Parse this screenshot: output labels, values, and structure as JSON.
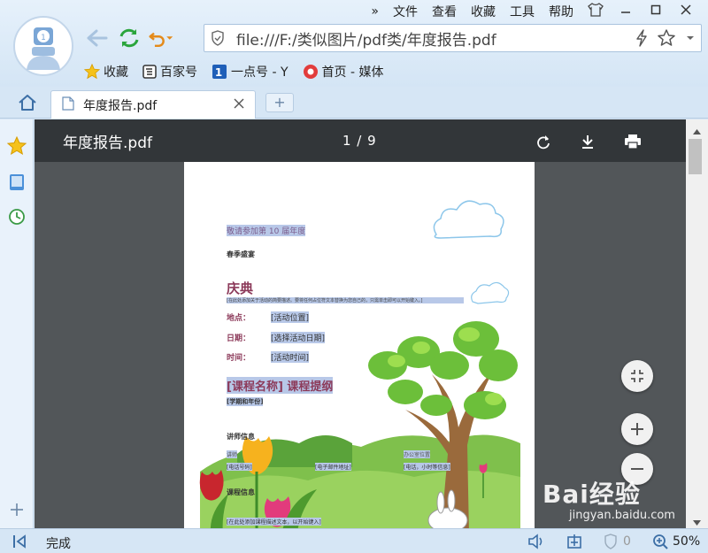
{
  "menu": {
    "file": "文件",
    "view": "查看",
    "favorites": "收藏",
    "tools": "工具",
    "help": "帮助",
    "more": "»"
  },
  "address": {
    "url": "file:///F:/类似图片/pdf类/年度报告.pdf"
  },
  "bookmarks": [
    {
      "label": "收藏"
    },
    {
      "label": "百家号"
    },
    {
      "label": "一点号 - Y"
    },
    {
      "label": "首页 - 媒体"
    }
  ],
  "tab": {
    "title": "年度报告.pdf",
    "new_tab": "+"
  },
  "pdf": {
    "filename": "年度报告.pdf",
    "page_indicator": "1 / 9",
    "content": {
      "invite": "敬请参加第",
      "invite_num": "10",
      "invite_suffix": "届年度",
      "season": "春季盛宴",
      "heading": "庆典",
      "desc": "[在此处添加关于活动的简要描述。要将任何占位符文本替换为您自己的，只需单击即可以开始键入。]",
      "place_label": "地点：",
      "place_val": "[活动位置]",
      "date_label": "日期：",
      "date_val": "[选择活动日期]",
      "time_label": "时间：",
      "time_val": "[活动时间]",
      "course": "[课程名称] 课程提纲",
      "term": "[学期和年份]",
      "teacher": "讲师信息",
      "name": "讲师",
      "office": "办公室位置",
      "email": "[电子邮件地址]",
      "hours": "[电话，小时等信息]",
      "phone": "[电话号码]",
      "course_info": "课程信息",
      "bottom_note": "[在此处添加课程描述文本，以开始键入]"
    }
  },
  "status": {
    "text": "完成",
    "shield_count": "0",
    "zoom": "50%"
  },
  "watermark": {
    "brand": "Bai经验",
    "url": "jingyan.baidu.com"
  },
  "colors": {
    "accent": "#2d7fd0",
    "toolbar": "#323639",
    "viewer_bg": "#525659"
  }
}
